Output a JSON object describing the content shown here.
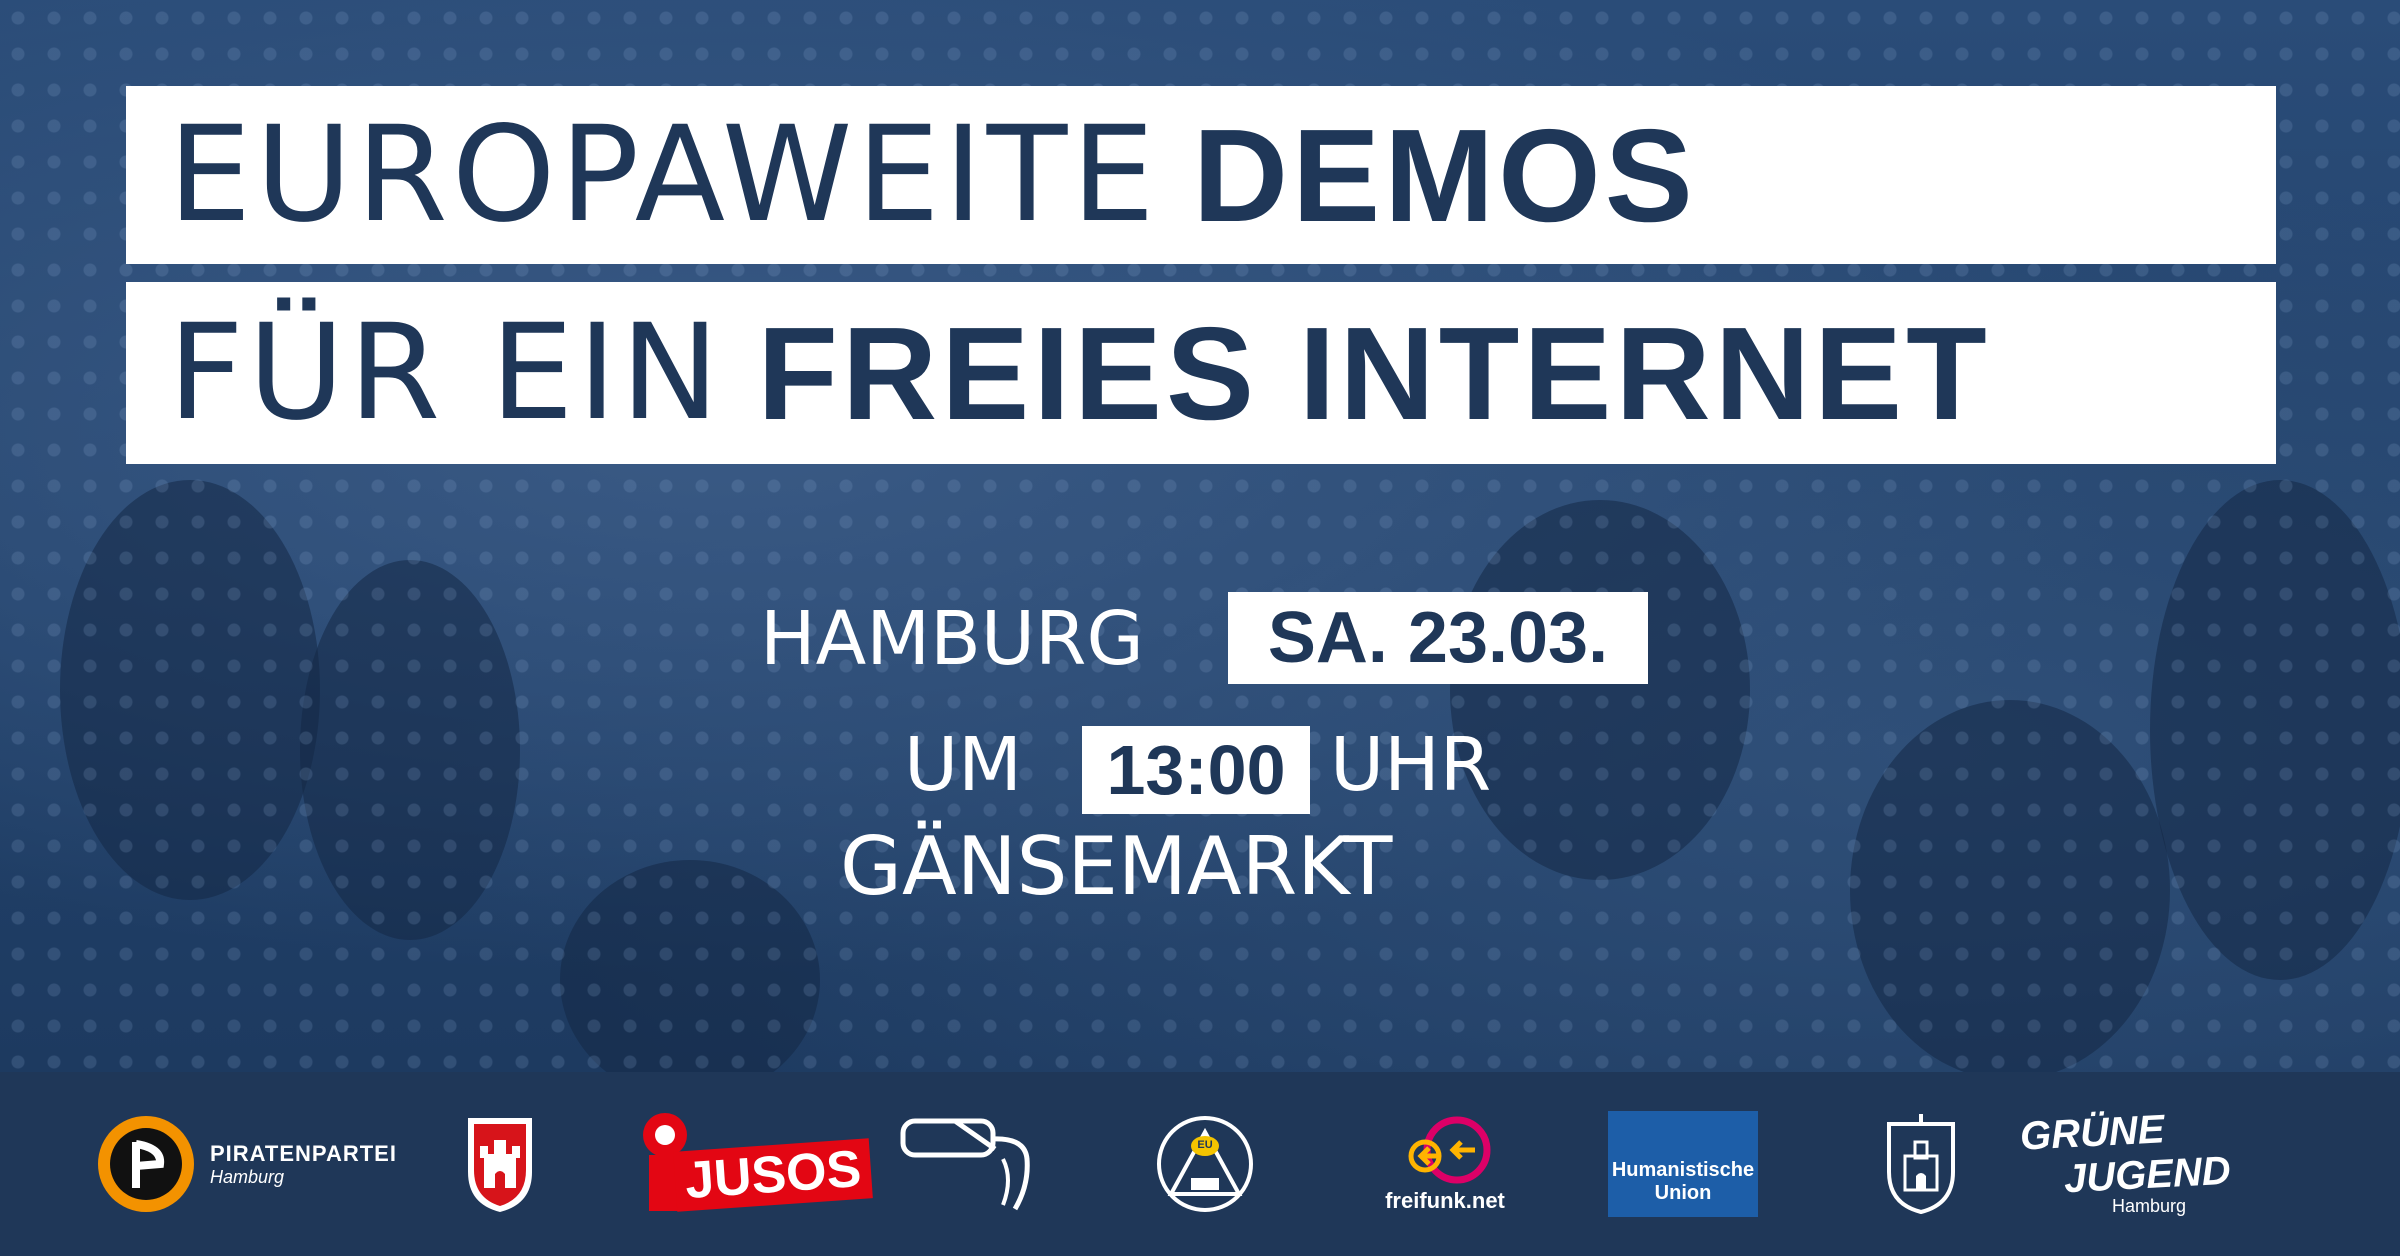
{
  "headline": {
    "line1_light": "EUROPAWEITE",
    "line1_bold": "DEMOS",
    "line2_light": "FÜR EIN",
    "line2_bold": "FREIES INTERNET"
  },
  "event": {
    "city": "HAMBURG",
    "date": "SA. 23.03.",
    "time_prefix": "UM",
    "time": "13:00",
    "time_suffix": "UHR",
    "location": "GÄNSEMARKT"
  },
  "logos": {
    "piraten_name": "PIRATENPARTEI",
    "piraten_sub": "Hamburg",
    "jusos": "JUSOS",
    "eu_badge": "EU",
    "freifunk": "freifunk.net",
    "humanistische_line1": "Humanistische",
    "humanistische_line2": "Union",
    "gruene_line1": "GRÜNE",
    "gruene_line2": "JUGEND",
    "gruene_sub": "Hamburg"
  },
  "colors": {
    "navy": "#1f3758",
    "jusos_red": "#e30613",
    "piraten_orange": "#f39200",
    "humanistische_blue": "#1d5ea8",
    "freifunk_pink": "#dc0067"
  }
}
